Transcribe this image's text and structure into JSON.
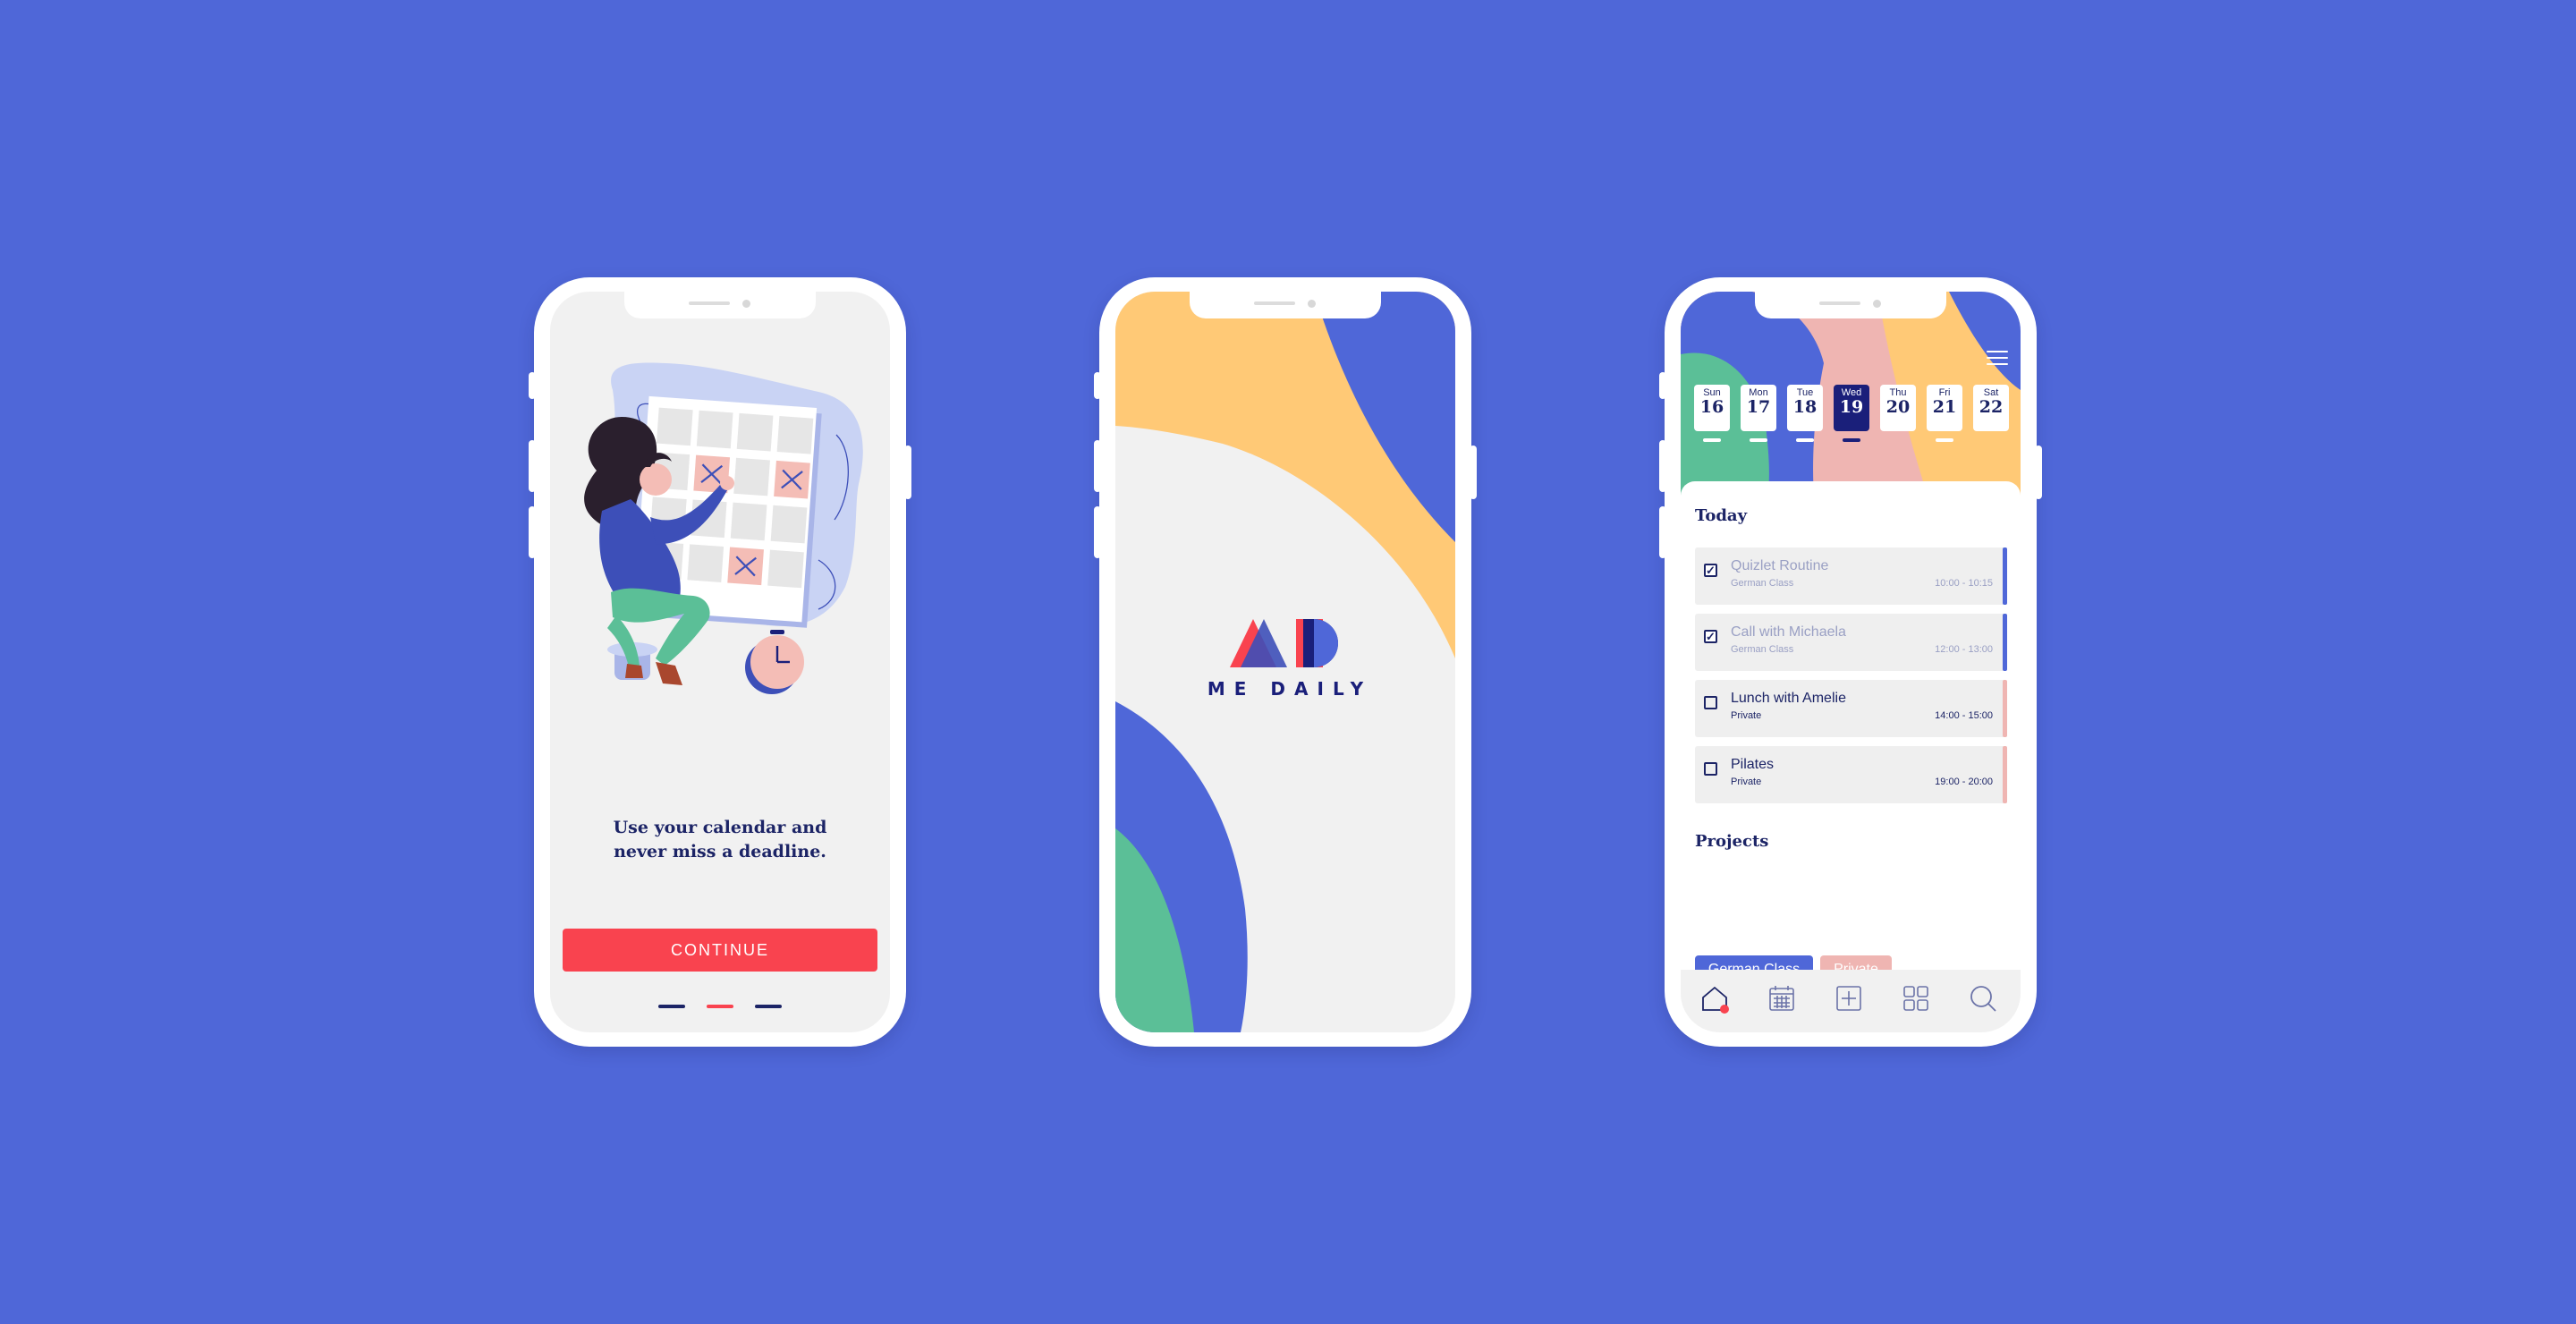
{
  "onboarding": {
    "message": "Use your calendar and never miss a deadline.",
    "continue_label": "CONTINUE",
    "pager": {
      "pages": 3,
      "active_index": 1
    }
  },
  "splash": {
    "brand_name": "ME DAILY"
  },
  "calendar": {
    "week": [
      {
        "day": "Sun",
        "date": "16",
        "selected": false,
        "has_events": true
      },
      {
        "day": "Mon",
        "date": "17",
        "selected": false,
        "has_events": true
      },
      {
        "day": "Tue",
        "date": "18",
        "selected": false,
        "has_events": true
      },
      {
        "day": "Wed",
        "date": "19",
        "selected": true,
        "has_events": true
      },
      {
        "day": "Thu",
        "date": "20",
        "selected": false,
        "has_events": false
      },
      {
        "day": "Fri",
        "date": "21",
        "selected": false,
        "has_events": true
      },
      {
        "day": "Sat",
        "date": "22",
        "selected": false,
        "has_events": false
      }
    ],
    "today_title": "Today",
    "tasks": [
      {
        "title": "Quizlet Routine",
        "project": "German Class",
        "time": "10:00 - 10:15",
        "done": true,
        "color": "#4f67d8"
      },
      {
        "title": "Call with Michaela",
        "project": "German Class",
        "time": "12:00 - 13:00",
        "done": true,
        "color": "#4f67d8"
      },
      {
        "title": "Lunch with Amelie",
        "project": "Private",
        "time": "14:00 - 15:00",
        "done": false,
        "color": "#efb5b2"
      },
      {
        "title": "Pilates",
        "project": "Private",
        "time": "19:00 - 20:00",
        "done": false,
        "color": "#efb5b2"
      }
    ],
    "projects_title": "Projects",
    "projects": [
      {
        "label": "German Class",
        "color": "#4f67d8"
      },
      {
        "label": "Private",
        "color": "#efb5b2"
      }
    ],
    "tabbar": [
      "home-icon",
      "calendar-icon",
      "add-icon",
      "grid-icon",
      "search-icon"
    ]
  },
  "colors": {
    "background": "#4f67d8",
    "navy": "#1a1f7a",
    "red": "#f9434f",
    "yellow": "#ffc976",
    "green": "#5bbf97",
    "pink": "#efb5b2"
  }
}
